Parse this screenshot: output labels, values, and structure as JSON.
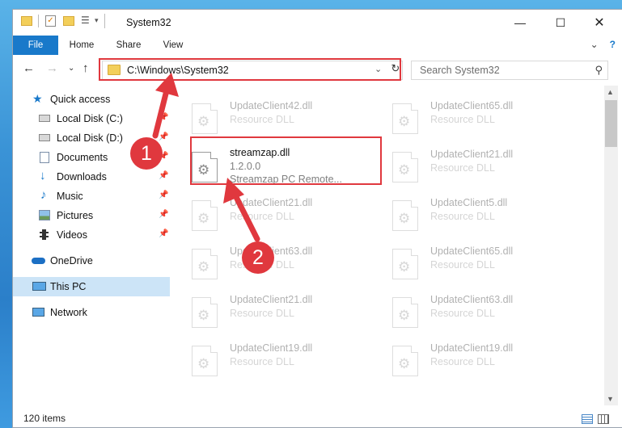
{
  "window": {
    "title": "System32"
  },
  "ribbon": {
    "tabs": [
      "File",
      "Home",
      "Share",
      "View"
    ]
  },
  "address": {
    "path": "C:\\Windows\\System32",
    "search_placeholder": "Search System32"
  },
  "nav": {
    "items": [
      {
        "label": "Quick access",
        "icon": "star-icon",
        "pinned": false
      },
      {
        "label": "Local Disk (C:)",
        "icon": "drive-icon",
        "pinned": true
      },
      {
        "label": "Local Disk (D:)",
        "icon": "drive-icon",
        "pinned": true
      },
      {
        "label": "Documents",
        "icon": "documents-icon",
        "pinned": true
      },
      {
        "label": "Downloads",
        "icon": "download-icon",
        "pinned": true
      },
      {
        "label": "Music",
        "icon": "music-icon",
        "pinned": true
      },
      {
        "label": "Pictures",
        "icon": "pictures-icon",
        "pinned": true
      },
      {
        "label": "Videos",
        "icon": "videos-icon",
        "pinned": true
      },
      {
        "label": "OneDrive",
        "icon": "cloud-icon",
        "pinned": false
      },
      {
        "label": "This PC",
        "icon": "pc-icon",
        "pinned": false
      },
      {
        "label": "Network",
        "icon": "network-icon",
        "pinned": false
      }
    ]
  },
  "files": {
    "left": [
      {
        "name": "UpdateClient42.dll",
        "type": "Resource DLL"
      },
      {
        "name": "streamzap.dll",
        "version": "1.2.0.0",
        "desc": "Streamzap PC Remote..."
      },
      {
        "name": "UpdateClient21.dll",
        "type": "Resource DLL"
      },
      {
        "name": "UpdateClient63.dll",
        "type": "Resource DLL"
      },
      {
        "name": "UpdateClient21.dll",
        "type": "Resource DLL"
      },
      {
        "name": "UpdateClient19.dll",
        "type": "Resource DLL"
      }
    ],
    "right": [
      {
        "name": "UpdateClient65.dll",
        "type": "Resource DLL"
      },
      {
        "name": "UpdateClient21.dll",
        "type": "Resource DLL"
      },
      {
        "name": "UpdateClient5.dll",
        "type": "Resource DLL"
      },
      {
        "name": "UpdateClient65.dll",
        "type": "Resource DLL"
      },
      {
        "name": "UpdateClient63.dll",
        "type": "Resource DLL"
      },
      {
        "name": "UpdateClient19.dll",
        "type": "Resource DLL"
      }
    ]
  },
  "status": {
    "item_count": "120 items"
  },
  "callouts": [
    "1",
    "2"
  ],
  "colors": {
    "accent": "#1979ca",
    "highlight": "#e0383e",
    "selected": "#cce4f7"
  }
}
